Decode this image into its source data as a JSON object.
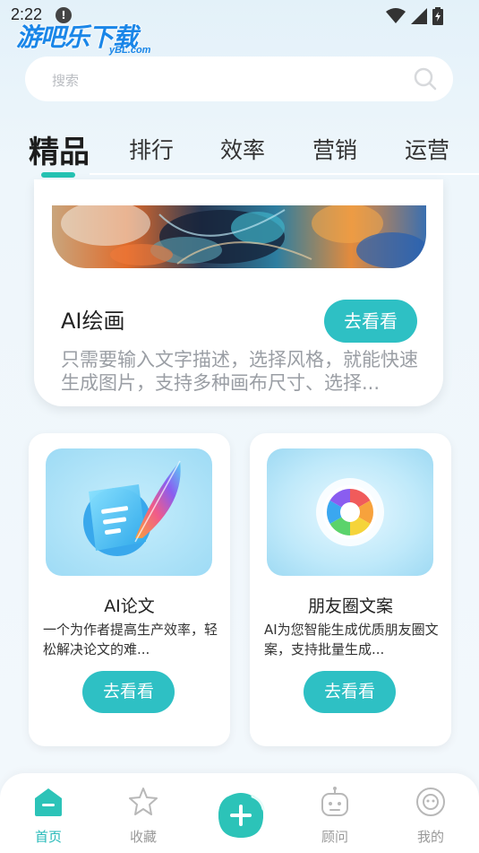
{
  "status": {
    "time": "2:22",
    "notif": "!"
  },
  "watermark": {
    "text": "游吧乐下载",
    "sub": "yBL.com"
  },
  "search": {
    "placeholder": "搜索"
  },
  "tabs": [
    {
      "label": "精品"
    },
    {
      "label": "排行"
    },
    {
      "label": "效率"
    },
    {
      "label": "营销"
    },
    {
      "label": "运营"
    }
  ],
  "featured": {
    "title": "AI绘画",
    "button": "去看看",
    "description": "只需要输入文字描述，选择风格，就能快速生成图片，支持多种画布尺寸、选择..."
  },
  "cards": [
    {
      "title": "AI论文",
      "description": "一个为作者提高生产效率，轻松解决论文的难...",
      "button": "去看看",
      "icon": "document-feather-icon"
    },
    {
      "title": "朋友圈文案",
      "description": "AI为您智能生成优质朋友圈文案，支持批量生成...",
      "button": "去看看",
      "icon": "camera-aperture-icon"
    }
  ],
  "nav": [
    {
      "label": "首页",
      "icon": "home-icon"
    },
    {
      "label": "收藏",
      "icon": "star-icon"
    },
    {
      "label": "",
      "icon": "add-icon"
    },
    {
      "label": "顾问",
      "icon": "robot-icon"
    },
    {
      "label": "我的",
      "icon": "profile-icon"
    }
  ],
  "colors": {
    "accent": "#2ec0c4",
    "tab_indicator": "#25c2b2",
    "active_nav": "#25b9b8"
  }
}
